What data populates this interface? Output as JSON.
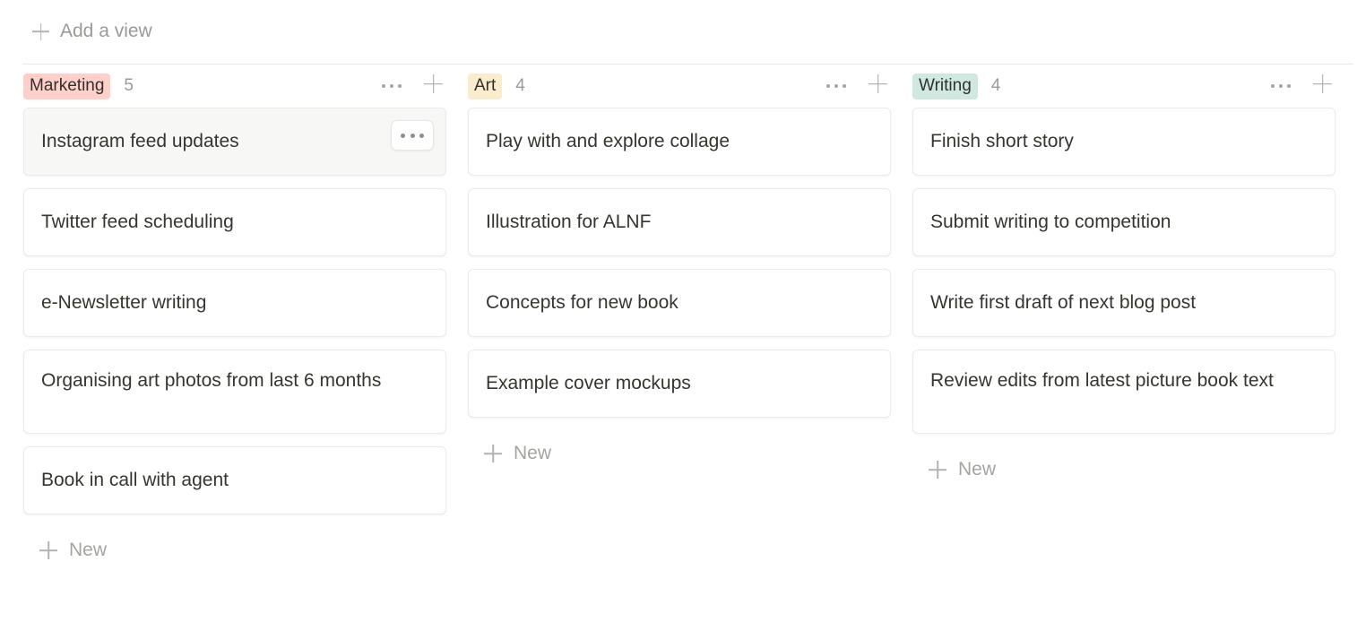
{
  "toolbar": {
    "add_view_label": "Add a view",
    "add_view_icon": "plus-icon"
  },
  "board": {
    "new_label": "New",
    "menu_icon": "ellipsis-icon",
    "add_icon": "plus-icon",
    "columns": [
      {
        "name": "Marketing",
        "count": "5",
        "color": "#ffcfc9",
        "new_label": "New",
        "cards": [
          {
            "title": "Instagram feed updates",
            "hovered": true,
            "tall": false
          },
          {
            "title": "Twitter feed scheduling",
            "hovered": false,
            "tall": false
          },
          {
            "title": "e-Newsletter writing",
            "hovered": false,
            "tall": false
          },
          {
            "title": "Organising art photos from last 6 months",
            "hovered": false,
            "tall": true
          },
          {
            "title": "Book in call with agent",
            "hovered": false,
            "tall": false
          }
        ]
      },
      {
        "name": "Art",
        "count": "4",
        "color": "#faedcd",
        "new_label": "New",
        "cards": [
          {
            "title": "Play with and explore collage",
            "hovered": false,
            "tall": false
          },
          {
            "title": "Illustration for ALNF",
            "hovered": false,
            "tall": false
          },
          {
            "title": "Concepts for new book",
            "hovered": false,
            "tall": false
          },
          {
            "title": "Example cover mockups",
            "hovered": false,
            "tall": false
          }
        ]
      },
      {
        "name": "Writing",
        "count": "4",
        "color": "#cfe9e0",
        "new_label": "New",
        "cards": [
          {
            "title": "Finish short story",
            "hovered": false,
            "tall": false
          },
          {
            "title": "Submit writing to competition",
            "hovered": false,
            "tall": false
          },
          {
            "title": "Write first draft of next blog post",
            "hovered": false,
            "tall": false
          },
          {
            "title": "Review edits from latest picture book text",
            "hovered": false,
            "tall": true
          }
        ]
      }
    ]
  }
}
